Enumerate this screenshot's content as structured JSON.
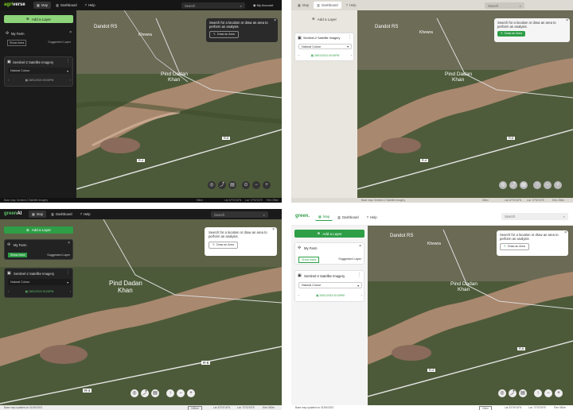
{
  "colors": {
    "green": "#2e9e47",
    "dark_bg": "#1f1f1f",
    "light_bg": "#f4f4f4"
  },
  "p1": {
    "logo_a": "agri",
    "logo_b": "verse",
    "nav": {
      "map": "Map",
      "dashboard": "Dashboard",
      "help": "Help"
    },
    "search": "Search",
    "account": "My Account",
    "add_layer": "Add a Layer",
    "farm": {
      "title": "My Farm",
      "show_area": "Show Area",
      "suggested": "Suggested Layer"
    },
    "sentinel": {
      "title": "Sentinel-2 Satellite Imagery",
      "select": "Natural Colour",
      "date": "25/01/2024 00:00PM"
    },
    "popup": {
      "text": "Search for a location or draw an area to perform an analysis",
      "btn": "Draw an Area"
    },
    "status": {
      "base": "Base map: Sentinel-2 Satellite Imagery",
      "scale": "50km",
      "lat": "Lat 32°03'18\"N",
      "lon": "Lon 72°52'33\"E",
      "elev": "Elev 256m"
    }
  },
  "p2": {
    "nav": {
      "map": "Map",
      "dashboard": "Dashboard",
      "help": "Help"
    },
    "search": "Search",
    "add_layer": "Add a Layer",
    "sentinel": {
      "title": "Sentinel-2 Satellite Imagery",
      "select": "Natural Colour",
      "date": "25/01/2024 00:00PM"
    },
    "popup": {
      "text": "Search for a location or draw an area to perform an analysis.",
      "btn": "Draw an Area"
    },
    "status": {
      "base": "Base map: Sentinel-2 Satellite Imagery",
      "scale": "50km",
      "lat": "Lat 32°03'18\"N",
      "lon": "Lon 72°52'33\"E",
      "elev": "Elev 256m"
    }
  },
  "p3": {
    "logo_a": "green",
    "logo_b": "AI",
    "nav": {
      "map": "Map",
      "dashboard": "Dashboard",
      "help": "Help"
    },
    "search": "Search",
    "add_layer": "Add a Layer",
    "farm": {
      "title": "My Farm",
      "show_area": "Show Area",
      "suggested": "Suggested Layer"
    },
    "sentinel": {
      "title": "Sentinel-2 Satellite Imagery",
      "select": "Natural Colour",
      "date": "25/01/2024 00:00PM"
    },
    "popup": {
      "text": "Search for a location or draw an area to perform an analysis.",
      "btn": "Draw an Area"
    },
    "status": {
      "base": "Base map updated on 01/06/2023",
      "scale": "100km",
      "lat": "Lat 33°00'18\"N",
      "lon": "Lon 73°02'05\"E",
      "elev": "Elev 550m"
    }
  },
  "p4": {
    "logo": "green.",
    "nav": {
      "map": "Map",
      "dashboard": "Dashboard",
      "help": "Help"
    },
    "search": "Search",
    "add_layer": "Add a Layer",
    "farm": {
      "title": "My Farm",
      "show_area": "Show Area",
      "suggested": "Suggested Layer"
    },
    "sentinel": {
      "title": "Sentinel-2 Satellite Imagery",
      "select": "Natural Colour",
      "date": "25/01/2024 00:00PM"
    },
    "popup": {
      "text": "Search for a location or draw an area to perform an analysis",
      "btn": "Draw an Area"
    },
    "status": {
      "base": "Base map updated on 01/06/2023",
      "scale": "10km",
      "lat": "Lat 33°09'18\"N",
      "lon": "Lon 73°02'05\"E",
      "elev": "Elev 550m"
    }
  },
  "map_labels": {
    "dandot": "Dandot RS",
    "khewra": "Khewra",
    "pind_a": "Pind Dadan",
    "pind_b": "Khan",
    "r6": "R-6",
    "r4": "R-4"
  }
}
